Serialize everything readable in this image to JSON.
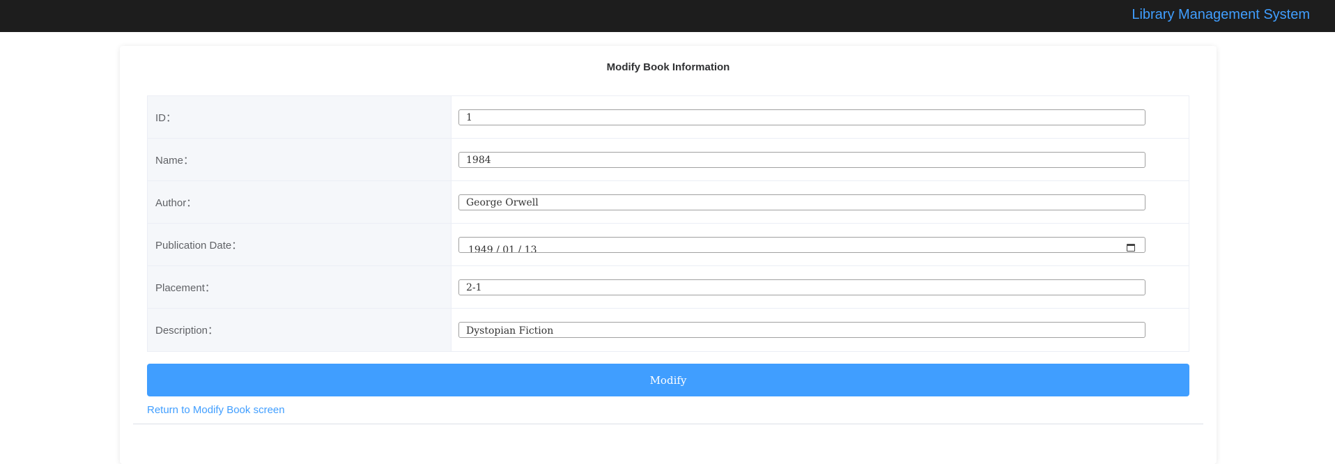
{
  "header": {
    "brand": "Library Management System"
  },
  "form": {
    "title": "Modify Book Information",
    "fields": {
      "id": {
        "label": "ID：",
        "value": "1"
      },
      "name": {
        "label": "Name：",
        "value": "1984"
      },
      "author": {
        "label": "Author：",
        "value": "George Orwell"
      },
      "publication": {
        "label": "Publication Date：",
        "value": "1949 / 01 / 13"
      },
      "placement": {
        "label": "Placement：",
        "value": "2-1"
      },
      "description": {
        "label": "Description：",
        "value": "Dystopian Fiction"
      }
    },
    "submit_label": "Modify",
    "return_link": "Return to Modify Book screen"
  },
  "colors": {
    "accent": "#409eff",
    "topbar": "#1d1d1d"
  }
}
